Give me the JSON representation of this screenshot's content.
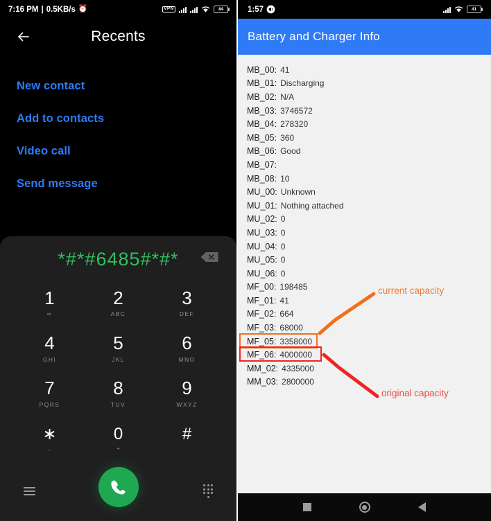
{
  "left_phone": {
    "status_bar": {
      "time": "7:16 PM",
      "separator": "|",
      "network_speed": "0.5KB/s",
      "alarm_icon": "alarm-icon",
      "vpn_label": "VPN",
      "signal_icon_1": "signal-bars-icon",
      "signal_icon_2": "signal-bars-icon",
      "wifi_icon": "wifi-icon",
      "battery_level": "84"
    },
    "app_bar": {
      "back_icon": "back-arrow-icon",
      "title": "Recents"
    },
    "menu": {
      "items": [
        {
          "label": "New contact"
        },
        {
          "label": "Add to contacts"
        },
        {
          "label": "Video call"
        },
        {
          "label": "Send message"
        }
      ]
    },
    "dialer": {
      "entered_number": "*#*#6485#*#*",
      "backspace_icon": "backspace-icon",
      "keys": [
        {
          "digit": "1",
          "sub": "∞"
        },
        {
          "digit": "2",
          "sub": "ABC"
        },
        {
          "digit": "3",
          "sub": "DEF"
        },
        {
          "digit": "4",
          "sub": "GHI"
        },
        {
          "digit": "5",
          "sub": "JKL"
        },
        {
          "digit": "6",
          "sub": "MNO"
        },
        {
          "digit": "7",
          "sub": "PQRS"
        },
        {
          "digit": "8",
          "sub": "TUV"
        },
        {
          "digit": "9",
          "sub": "WXYZ"
        },
        {
          "digit": "∗",
          "sub": ","
        },
        {
          "digit": "0",
          "sub": "+"
        },
        {
          "digit": "#",
          "sub": ""
        }
      ],
      "menu_icon": "hamburger-menu-icon",
      "call_icon": "phone-call-icon",
      "keypad_icon": "dialpad-icon",
      "call_button_color": "#1fa851",
      "number_color": "#2fbf5f"
    }
  },
  "right_phone": {
    "status_bar": {
      "time": "1:57",
      "volume_icon": "volume-icon",
      "signal_icon": "signal-bars-icon",
      "wifi_icon": "wifi-icon",
      "battery_level": "41"
    },
    "app_bar": {
      "title": "Battery and Charger Info",
      "color": "#2f7bf6"
    },
    "info_rows": [
      {
        "key": "MB_00:",
        "value": "41"
      },
      {
        "key": "MB_01:",
        "value": "Discharging"
      },
      {
        "key": "MB_02:",
        "value": "N/A"
      },
      {
        "key": "MB_03:",
        "value": "3746572"
      },
      {
        "key": "MB_04:",
        "value": "278320"
      },
      {
        "key": "MB_05:",
        "value": "360"
      },
      {
        "key": "MB_06:",
        "value": "Good"
      },
      {
        "key": "MB_07:",
        "value": ""
      },
      {
        "key": "MB_08:",
        "value": "10"
      },
      {
        "key": "MU_00:",
        "value": "Unknown"
      },
      {
        "key": "MU_01:",
        "value": "Nothing attached"
      },
      {
        "key": "MU_02:",
        "value": "0"
      },
      {
        "key": "MU_03:",
        "value": "0"
      },
      {
        "key": "MU_04:",
        "value": "0"
      },
      {
        "key": "MU_05:",
        "value": "0"
      },
      {
        "key": "MU_06:",
        "value": "0"
      },
      {
        "key": "MF_00:",
        "value": "198485"
      },
      {
        "key": "MF_01:",
        "value": "41"
      },
      {
        "key": "MF_02:",
        "value": "664"
      },
      {
        "key": "MF_03:",
        "value": "68000"
      },
      {
        "key": "MF_05:",
        "value": "3358000"
      },
      {
        "key": "MF_06:",
        "value": "4000000"
      },
      {
        "key": "MM_02:",
        "value": "4335000"
      },
      {
        "key": "MM_03:",
        "value": "2800000"
      }
    ],
    "annotations": [
      {
        "text": "current capacity",
        "color": "#ef7b36",
        "target_key": "MF_05"
      },
      {
        "text": "original capacity",
        "color": "#ea4a4a",
        "target_key": "MF_06"
      }
    ],
    "highlight_colors": {
      "current": "#f0701e",
      "original": "#ef2424"
    },
    "nav_bar": {
      "recents_icon": "square-recents-icon",
      "home_icon": "circle-home-icon",
      "back_icon": "triangle-back-icon"
    }
  }
}
